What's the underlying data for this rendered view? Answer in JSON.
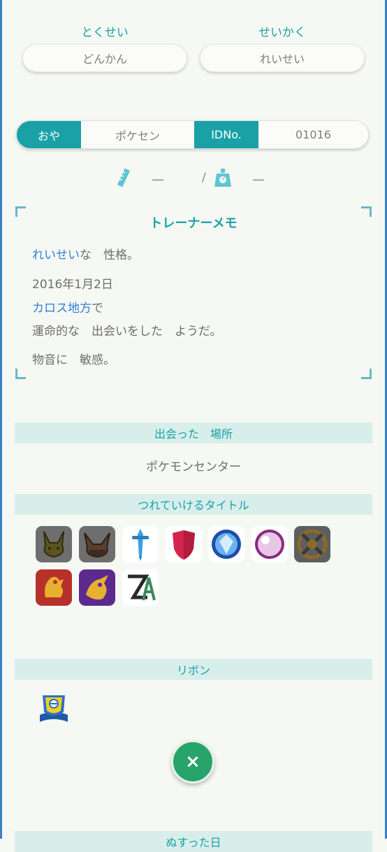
{
  "ability": {
    "label": "とくせい",
    "value": "どんかん"
  },
  "nature": {
    "label": "せいかく",
    "value": "れいせい"
  },
  "owner": {
    "ot_label": "おや",
    "ot_value": "ポケセン",
    "id_label": "IDNo.",
    "id_value": "01016"
  },
  "measurements": {
    "height_value": "ー",
    "separator": "/",
    "weight_value": "ー"
  },
  "memo": {
    "title": "トレーナーメモ",
    "nature_word": "れいせい",
    "nature_suffix": "な　性格。",
    "date": "2016年1月2日",
    "region": "カロス地方",
    "region_suffix": "で",
    "meeting": "運命的な　出会いをした　ようだ。",
    "characteristic": "物音に　敏感。"
  },
  "met_location": {
    "header": "出会った　場所",
    "value": "ポケモンセンター"
  },
  "titles": {
    "header": "つれていけるタイトル",
    "icons": [
      "pikachu-game-icon",
      "eevee-game-icon",
      "sword-icon",
      "shield-icon",
      "brilliant-diamond-icon",
      "shining-pearl-icon",
      "legends-arceus-icon",
      "scarlet-icon",
      "violet-icon",
      "legends-za-icon"
    ]
  },
  "ribbons": {
    "header": "リボン",
    "items": [
      "classic-ribbon-icon"
    ]
  },
  "close_label": "×",
  "next_header": "ぬすった日"
}
